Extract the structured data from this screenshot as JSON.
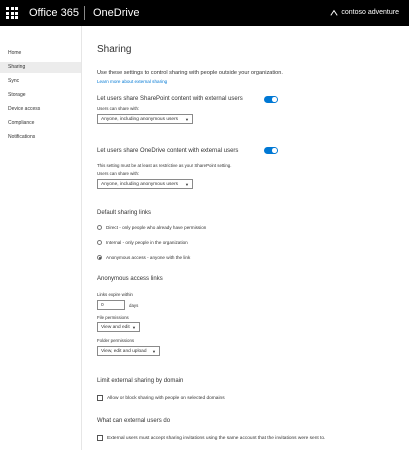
{
  "header": {
    "brand": "Office 365",
    "product": "OneDrive",
    "tenant": "contoso adventure"
  },
  "sidebar": {
    "items": [
      {
        "label": "Home"
      },
      {
        "label": "Sharing",
        "selected": true
      },
      {
        "label": "Sync"
      },
      {
        "label": "Storage"
      },
      {
        "label": "Device access"
      },
      {
        "label": "Compliance"
      },
      {
        "label": "Notifications"
      }
    ]
  },
  "page": {
    "title": "Sharing",
    "intro": "Use these settings to control sharing with people outside your organization.",
    "learn_more": "Learn more about external sharing",
    "sharepoint": {
      "label": "Let users share SharePoint content with external users",
      "toggle_on": true,
      "users_can_share_label": "Users can share with:",
      "users_can_share_value": "Anyone, including anonymous users"
    },
    "onedrive": {
      "label": "Let users share OneDrive content with external users",
      "toggle_on": true,
      "note": "This setting must be at least as restrictive as your SharePoint setting.",
      "users_can_share_label": "Users can share with:",
      "users_can_share_value": "Anyone, including anonymous users"
    },
    "default_links": {
      "heading": "Default sharing links",
      "options": [
        {
          "label": "Direct - only people who already have permission",
          "selected": false
        },
        {
          "label": "Internal - only people in the organization",
          "selected": false
        },
        {
          "label": "Anonymous access - anyone with the link",
          "selected": true
        }
      ]
    },
    "anonymous": {
      "heading": "Anonymous access links",
      "expire_label": "Links expire within",
      "expire_value": "0",
      "expire_unit": "days",
      "file_permissions_label": "File permissions",
      "file_permissions_value": "View and edit",
      "folder_permissions_label": "Folder permissions",
      "folder_permissions_value": "View, edit and upload"
    },
    "limit_domain": {
      "heading": "Limit external sharing by domain",
      "checkbox_label": "Allow or block sharing with people on selected domains",
      "checked": false
    },
    "external_users": {
      "heading": "What can external users do",
      "checkbox_label": "External users must accept sharing invitations using the same account that the invitations were sent to.",
      "checked": false
    }
  },
  "colors": {
    "accent": "#0078d4",
    "topbar": "#000000",
    "nav_selected": "#ececec"
  }
}
